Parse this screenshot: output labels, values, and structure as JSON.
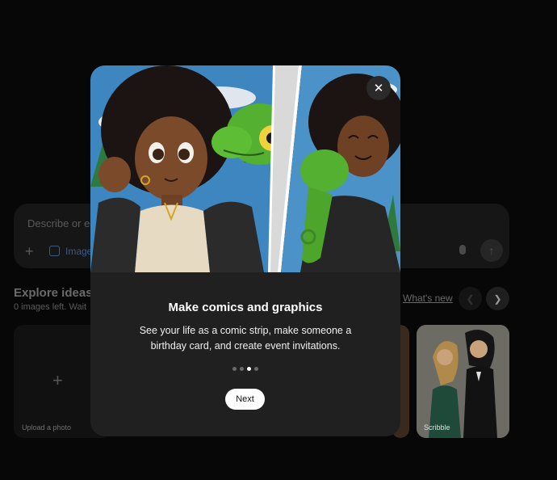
{
  "prompt": {
    "placeholder": "Describe or ed",
    "image_label": "Image"
  },
  "explore": {
    "title": "Explore ideas",
    "subtitle": "0 images left. Wait",
    "whats_new": "What's new",
    "upload_label": "Upload a photo",
    "scribble_label": "Scribble"
  },
  "modal": {
    "title": "Make comics and graphics",
    "description": "See your life as a comic strip, make someone a birthday card, and create event invitations.",
    "next_label": "Next",
    "close_label": "✕",
    "steps_total": 4,
    "step_active": 3
  },
  "icons": {
    "close": "close-icon",
    "plus": "plus-icon",
    "image": "image-icon",
    "mic": "mic-icon",
    "send": "send-arrow-icon",
    "chevron_left": "chevron-left-icon",
    "chevron_right": "chevron-right-icon"
  }
}
